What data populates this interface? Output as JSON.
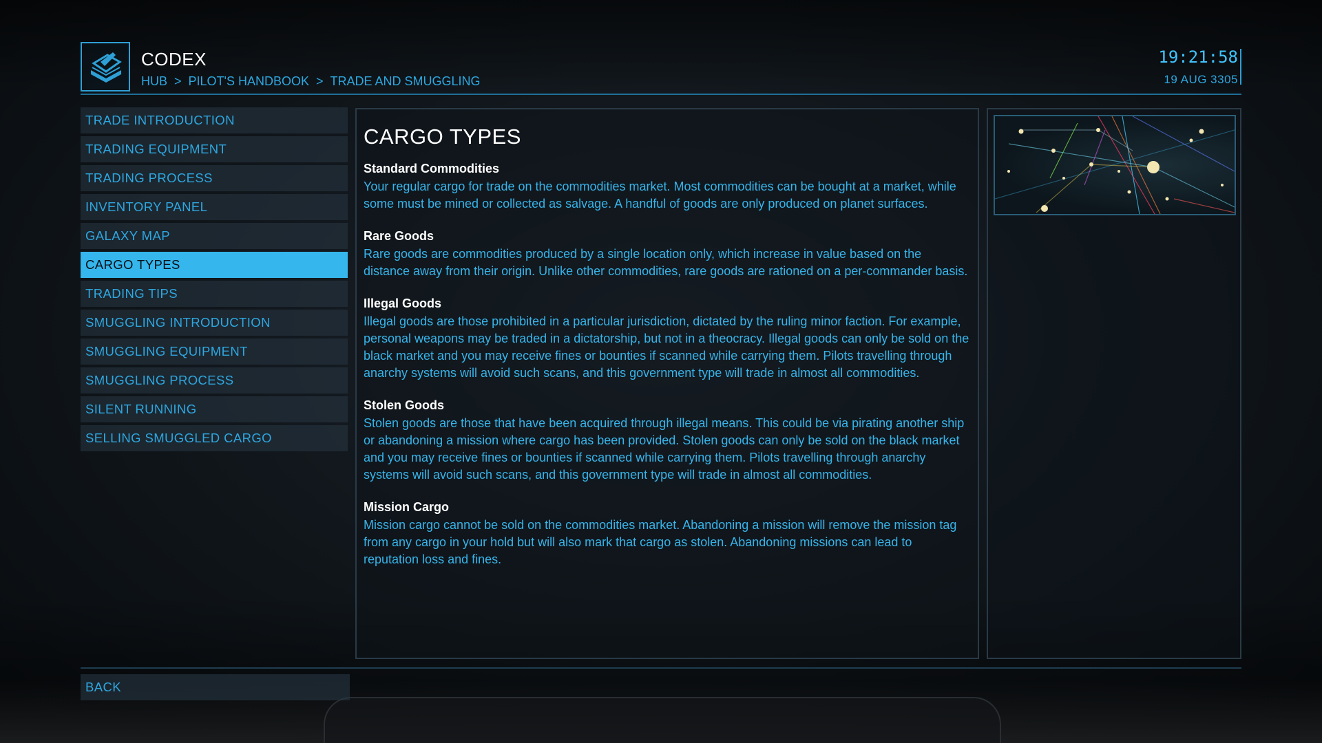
{
  "header": {
    "title": "CODEX",
    "breadcrumb": [
      "HUB",
      "PILOT'S HANDBOOK",
      "TRADE AND SMUGGLING"
    ],
    "separator": ">",
    "time": "19:21:58",
    "date": "19 AUG 3305",
    "logo_icon": "codex-book-icon"
  },
  "nav": {
    "items": [
      {
        "label": "TRADE INTRODUCTION",
        "active": false
      },
      {
        "label": "TRADING EQUIPMENT",
        "active": false
      },
      {
        "label": "TRADING PROCESS",
        "active": false
      },
      {
        "label": "INVENTORY PANEL",
        "active": false
      },
      {
        "label": "GALAXY MAP",
        "active": false
      },
      {
        "label": "CARGO TYPES",
        "active": true
      },
      {
        "label": "TRADING TIPS",
        "active": false
      },
      {
        "label": "SMUGGLING INTRODUCTION",
        "active": false
      },
      {
        "label": "SMUGGLING EQUIPMENT",
        "active": false
      },
      {
        "label": "SMUGGLING PROCESS",
        "active": false
      },
      {
        "label": "SILENT RUNNING",
        "active": false
      },
      {
        "label": "SELLING SMUGGLED CARGO",
        "active": false
      }
    ]
  },
  "main": {
    "title": "CARGO TYPES",
    "sections": [
      {
        "heading": "Standard Commodities",
        "body": "Your regular cargo for trade on the commodities market. Most commodities can be bought at a market, while some must be mined or collected as salvage. A handful of goods are only produced on planet surfaces."
      },
      {
        "heading": "Rare Goods",
        "body": "Rare goods are commodities produced by a single location only, which increase in value based on the distance away from their origin. Unlike other commodities, rare goods are rationed on a per-commander basis."
      },
      {
        "heading": "Illegal Goods",
        "body": "Illegal goods are those prohibited in a particular jurisdiction, dictated by the ruling minor faction. For example, personal weapons may be traded in a dictatorship, but not in a theocracy. Illegal goods can only be sold on the black market and you may receive fines or bounties if scanned while carrying them. Pilots travelling through anarchy systems will avoid such scans, and this government type will trade in almost all commodities."
      },
      {
        "heading": "Stolen Goods",
        "body": "Stolen goods are those that have been acquired through illegal means. This could be via pirating another ship or abandoning a mission where cargo has been provided. Stolen goods can only be sold on the black market and you may receive fines or bounties if scanned while carrying them. Pilots travelling through anarchy systems will avoid such scans, and this government type will trade in almost all commodities."
      },
      {
        "heading": "Mission Cargo",
        "body": "Mission cargo cannot be sold on the commodities market. Abandoning a mission will remove the mission tag from any cargo in your hold but will also mark that cargo as stolen. Abandoning missions can lead to reputation loss and fines."
      }
    ]
  },
  "side": {
    "image_icon": "galaxy-map-thumbnail"
  },
  "footer": {
    "back_label": "BACK"
  },
  "colors": {
    "accent": "#35b6ec",
    "text": "#37b4ea",
    "heading": "#ffffff"
  }
}
